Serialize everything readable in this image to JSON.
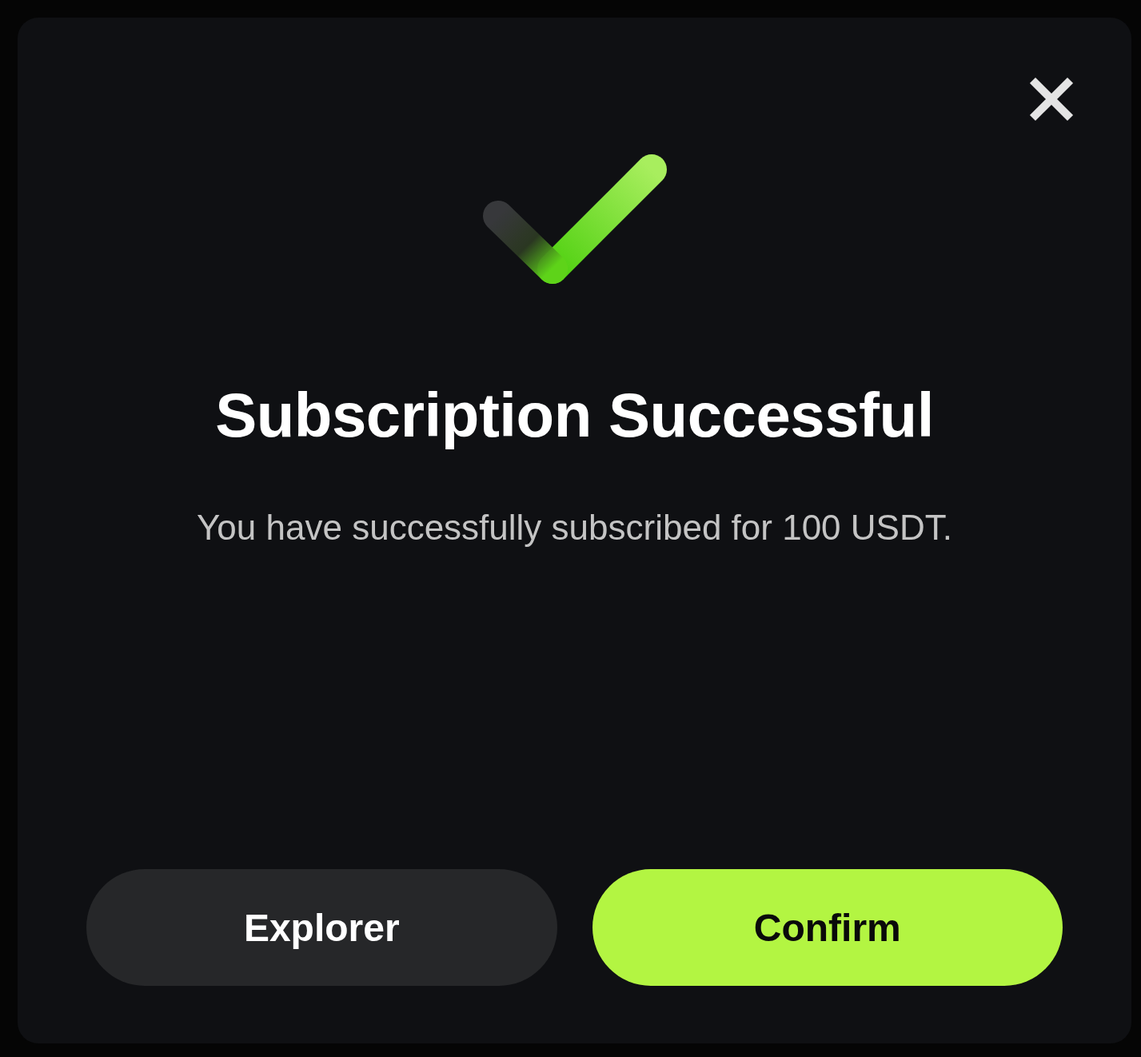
{
  "dialog": {
    "title": "Subscription Successful",
    "message": "You have successfully subscribed for 100 USDT.",
    "buttons": [
      {
        "label": "Explorer",
        "kind": "secondary"
      },
      {
        "label": "Confirm",
        "kind": "primary"
      }
    ]
  }
}
